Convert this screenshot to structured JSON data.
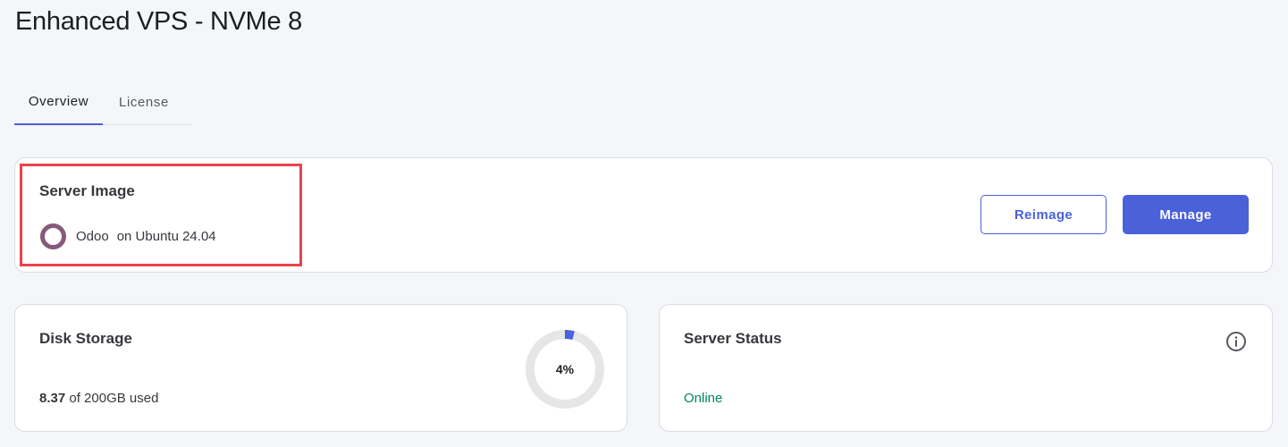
{
  "page": {
    "title": "Enhanced VPS - NVMe 8"
  },
  "tabs": [
    {
      "label": "Overview",
      "active": true
    },
    {
      "label": "License",
      "active": false
    }
  ],
  "server_image": {
    "title": "Server Image",
    "os_name": "Odoo",
    "os_base": "on Ubuntu 24.04",
    "icon": "odoo-icon",
    "reimage_label": "Reimage",
    "manage_label": "Manage"
  },
  "disk_storage": {
    "title": "Disk Storage",
    "used": "8.37",
    "of_total": "of 200GB used",
    "percent": 4,
    "percent_label": "4%"
  },
  "server_status": {
    "title": "Server Status",
    "status": "Online",
    "icon": "info-icon"
  },
  "colors": {
    "accent": "#4a61d9",
    "online": "#00875a",
    "odoo": "#875a7b",
    "highlight": "#e8434a",
    "track": "#e6e6e6"
  }
}
